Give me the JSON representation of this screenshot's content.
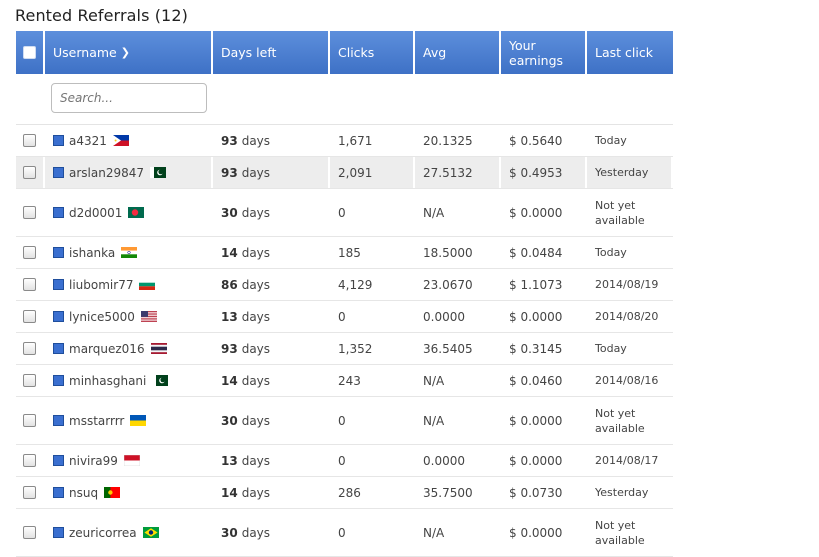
{
  "title": "Rented Referrals (12)",
  "search": {
    "placeholder": "Search..."
  },
  "columns": {
    "username": "Username",
    "days_left": "Days left",
    "clicks": "Clicks",
    "avg": "Avg",
    "earnings": "Your earnings",
    "last_click": "Last click"
  },
  "rows": [
    {
      "username": "a4321",
      "flag": "PH",
      "days": "93",
      "days_unit": "days",
      "clicks": "1,671",
      "avg": "20.1325",
      "earnings": "$ 0.5640",
      "last": "Today"
    },
    {
      "username": "arslan29847",
      "flag": "PK",
      "days": "93",
      "days_unit": "days",
      "clicks": "2,091",
      "avg": "27.5132",
      "earnings": "$ 0.4953",
      "last": "Yesterday"
    },
    {
      "username": "d2d0001",
      "flag": "BD",
      "days": "30",
      "days_unit": "days",
      "clicks": "0",
      "avg": "N/A",
      "earnings": "$ 0.0000",
      "last": "Not yet available"
    },
    {
      "username": "ishanka",
      "flag": "IN",
      "days": "14",
      "days_unit": "days",
      "clicks": "185",
      "avg": "18.5000",
      "earnings": "$ 0.0484",
      "last": "Today"
    },
    {
      "username": "liubomir77",
      "flag": "BG",
      "days": "86",
      "days_unit": "days",
      "clicks": "4,129",
      "avg": "23.0670",
      "earnings": "$ 1.1073",
      "last": "2014/08/19"
    },
    {
      "username": "lynice5000",
      "flag": "US",
      "days": "13",
      "days_unit": "days",
      "clicks": "0",
      "avg": "0.0000",
      "earnings": "$ 0.0000",
      "last": "2014/08/20"
    },
    {
      "username": "marquez016",
      "flag": "TH",
      "days": "93",
      "days_unit": "days",
      "clicks": "1,352",
      "avg": "36.5405",
      "earnings": "$ 0.3145",
      "last": "Today"
    },
    {
      "username": "minhasghani",
      "flag": "PK",
      "days": "14",
      "days_unit": "days",
      "clicks": "243",
      "avg": "N/A",
      "earnings": "$ 0.0460",
      "last": "2014/08/16"
    },
    {
      "username": "msstarrrr",
      "flag": "UA",
      "days": "30",
      "days_unit": "days",
      "clicks": "0",
      "avg": "N/A",
      "earnings": "$ 0.0000",
      "last": "Not yet available"
    },
    {
      "username": "nivira99",
      "flag": "ID",
      "days": "13",
      "days_unit": "days",
      "clicks": "0",
      "avg": "0.0000",
      "earnings": "$ 0.0000",
      "last": "2014/08/17"
    },
    {
      "username": "nsuq",
      "flag": "PT",
      "days": "14",
      "days_unit": "days",
      "clicks": "286",
      "avg": "35.7500",
      "earnings": "$ 0.0730",
      "last": "Yesterday"
    },
    {
      "username": "zeuricorrea",
      "flag": "BR",
      "days": "30",
      "days_unit": "days",
      "clicks": "0",
      "avg": "N/A",
      "earnings": "$ 0.0000",
      "last": "Not yet available"
    }
  ],
  "colors": {
    "header_top": "#5d8fdc",
    "header_bottom": "#3e71c6",
    "row_alt": "#ededed",
    "user_square": "#3a6fd0"
  }
}
